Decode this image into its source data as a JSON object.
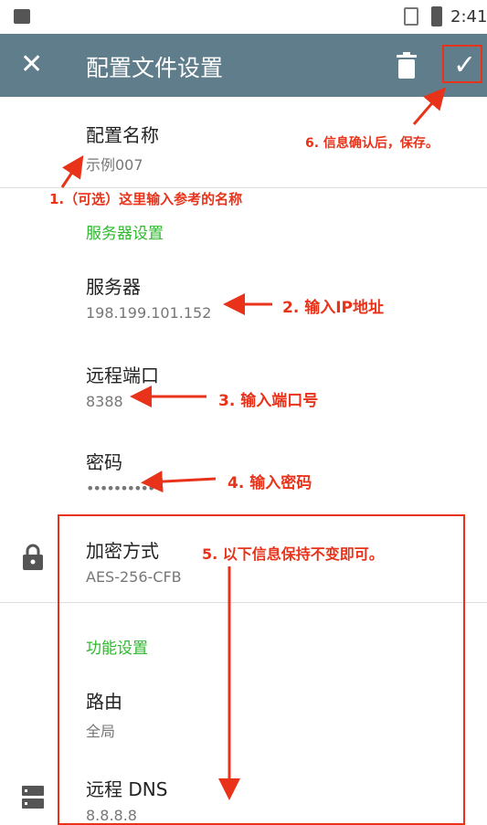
{
  "status_bar": {
    "time": "2:41"
  },
  "app_bar": {
    "title": "配置文件设置",
    "close_icon": "close-icon",
    "delete_icon": "trash-icon",
    "save_icon": "check-icon"
  },
  "profile": {
    "name_label": "配置名称",
    "name_value": "示例007"
  },
  "server_section": {
    "header": "服务器设置",
    "server_label": "服务器",
    "server_value": "198.199.101.152",
    "port_label": "远程端口",
    "port_value": "8388",
    "password_label": "密码",
    "password_value": "••••••••••",
    "encryption_label": "加密方式",
    "encryption_value": "AES-256-CFB"
  },
  "feature_section": {
    "header": "功能设置",
    "route_label": "路由",
    "route_value": "全局",
    "dns_label": "远程 DNS",
    "dns_value": "8.8.8.8"
  },
  "annotations": {
    "note1": "1.（可选）这里输入参考的名称",
    "note2": "2. 输入IP地址",
    "note3": "3. 输入端口号",
    "note4": "4. 输入密码",
    "note5": "5. 以下信息保持不变即可。",
    "note6": "6. 信息确认后，保存。"
  },
  "colors": {
    "app_bar": "#607d8b",
    "section_header": "#2eb82e",
    "annotation": "#e8331a"
  }
}
